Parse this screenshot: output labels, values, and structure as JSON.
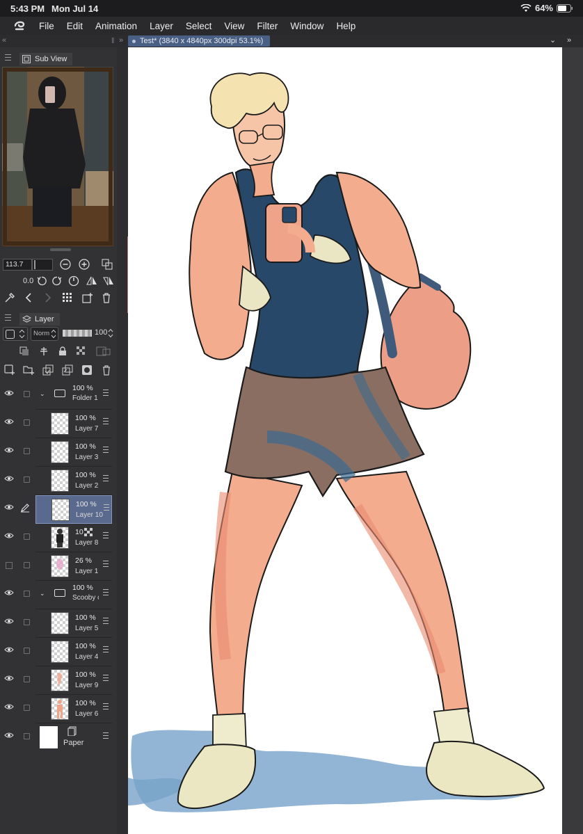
{
  "status_bar": {
    "time": "5:43 PM",
    "date": "Mon Jul 14",
    "battery": "64%"
  },
  "menu": [
    "File",
    "Edit",
    "Animation",
    "Layer",
    "Select",
    "View",
    "Filter",
    "Window",
    "Help"
  ],
  "tab": {
    "title": "Test* (3840 x 4840px 300dpi 53.1%)"
  },
  "subview": {
    "title": "Sub View",
    "zoom": "113.7",
    "rotation": "0.0"
  },
  "layer_panel": {
    "title": "Layer",
    "blend_mode": "Norm",
    "opacity": "100",
    "layers": [
      {
        "type": "folder",
        "opacity": "100 %",
        "name": "Folder 1",
        "expanded": true
      },
      {
        "type": "layer",
        "opacity": "100 %",
        "name": "Layer 7",
        "indent": true
      },
      {
        "type": "layer",
        "opacity": "100 %",
        "name": "Layer 3",
        "indent": true
      },
      {
        "type": "layer",
        "opacity": "100 %",
        "name": "Layer 2",
        "indent": true
      },
      {
        "type": "layer",
        "opacity": "100 %",
        "name": "Layer 10",
        "indent": true,
        "selected": true
      },
      {
        "type": "layer",
        "opacity": "10",
        "name": "Layer 8",
        "indent": true
      },
      {
        "type": "layer",
        "opacity": "26 %",
        "name": "Layer 1",
        "indent": true,
        "hidden": true
      },
      {
        "type": "folder",
        "opacity": "100 %",
        "name": "Scooby c",
        "expanded": true
      },
      {
        "type": "layer",
        "opacity": "100 %",
        "name": "Layer 5",
        "indent": true
      },
      {
        "type": "layer",
        "opacity": "100 %",
        "name": "Layer 4",
        "indent": true
      },
      {
        "type": "layer",
        "opacity": "100 %",
        "name": "Layer 9",
        "indent": true
      },
      {
        "type": "layer",
        "opacity": "100 %",
        "name": "Layer 6",
        "indent": true
      },
      {
        "type": "paper",
        "name": "Paper"
      }
    ]
  },
  "colors": {
    "tab_active": "#4a5f84",
    "layer_selected": "#5a6a8e",
    "tank_top": "#28486a",
    "shorts": "#8a6e62",
    "skin": "#f0a88a",
    "bag": "#ec9a80",
    "shadow": "#7aa6cc"
  }
}
